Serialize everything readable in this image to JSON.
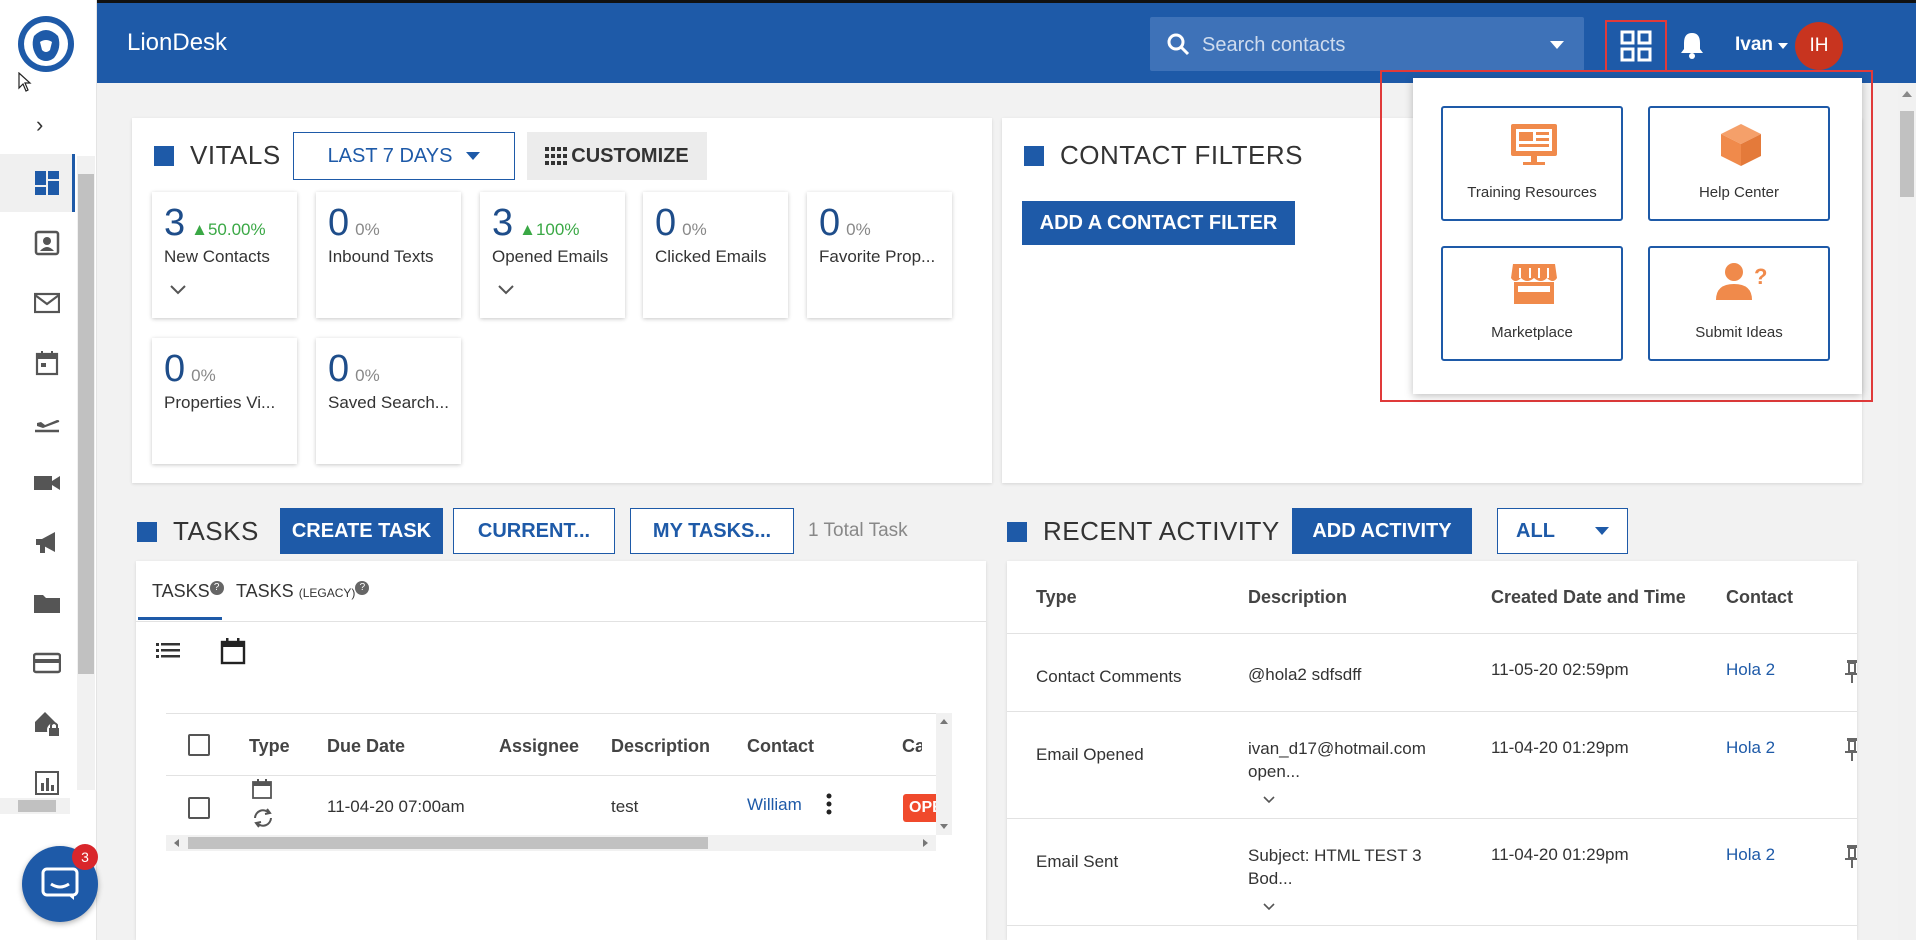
{
  "app": {
    "brand": "LionDesk"
  },
  "header": {
    "search_placeholder": "Search contacts",
    "user_name": "Ivan",
    "avatar_initials": "IH"
  },
  "chat": {
    "badge": "3"
  },
  "vitals": {
    "title": "VITALS",
    "range_label": "LAST 7 DAYS",
    "customize_label": "CUSTOMIZE",
    "cards": [
      {
        "value": "3",
        "pct": "▲50.00%",
        "label": "New Contacts"
      },
      {
        "value": "0",
        "pct": "0%",
        "label": "Inbound Texts"
      },
      {
        "value": "3",
        "pct": "▲100%",
        "label": "Opened Emails"
      },
      {
        "value": "0",
        "pct": "0%",
        "label": "Clicked Emails"
      },
      {
        "value": "0",
        "pct": "0%",
        "label": "Favorite Prop..."
      },
      {
        "value": "0",
        "pct": "0%",
        "label": "Properties Vi..."
      },
      {
        "value": "0",
        "pct": "0%",
        "label": "Saved Search..."
      }
    ]
  },
  "contact_filters": {
    "title": "CONTACT FILTERS",
    "add_label": "ADD A CONTACT FILTER"
  },
  "tasks": {
    "title": "TASKS",
    "create_label": "CREATE TASK",
    "current_label": "CURRENT...",
    "mytasks_label": "MY TASKS...",
    "total_label": "1 Total Task",
    "tab_tasks": "TASKS",
    "tab_legacy": "TASKS",
    "tab_legacy_suffix": "(LEGACY)",
    "columns": [
      "Type",
      "Due Date",
      "Assignee",
      "Description",
      "Contact",
      "Cate"
    ],
    "row": {
      "due": "11-04-20 07:00am",
      "assignee": "",
      "description": "test",
      "contact": "William",
      "category": "OPE"
    }
  },
  "recent_activity": {
    "title": "RECENT ACTIVITY",
    "add_label": "ADD ACTIVITY",
    "filter_label": "ALL",
    "columns": [
      "Type",
      "Description",
      "Created Date and Time",
      "Contact"
    ],
    "rows": [
      {
        "type": "Contact Comments",
        "description": "@hola2 sdfsdff",
        "description2": "",
        "date": "11-05-20 02:59pm",
        "contact": "Hola 2"
      },
      {
        "type": "Email Opened",
        "description": "ivan_d17@hotmail.com",
        "description2": "open...",
        "date": "11-04-20 01:29pm",
        "contact": "Hola 2"
      },
      {
        "type": "Email Sent",
        "description": "Subject: HTML TEST 3",
        "description2": "Bod...",
        "date": "11-04-20 01:29pm",
        "contact": "Hola 2"
      }
    ]
  },
  "apps_menu": {
    "tiles": [
      {
        "label": "Training Resources",
        "icon": "presentation-board-icon"
      },
      {
        "label": "Help Center",
        "icon": "cube-box-icon"
      },
      {
        "label": "Marketplace",
        "icon": "storefront-icon"
      },
      {
        "label": "Submit Ideas",
        "icon": "person-question-icon"
      }
    ]
  },
  "colors": {
    "brand_blue": "#1e5aa8",
    "accent_orange": "#f08a4b",
    "highlight_red": "#e03a3a"
  }
}
